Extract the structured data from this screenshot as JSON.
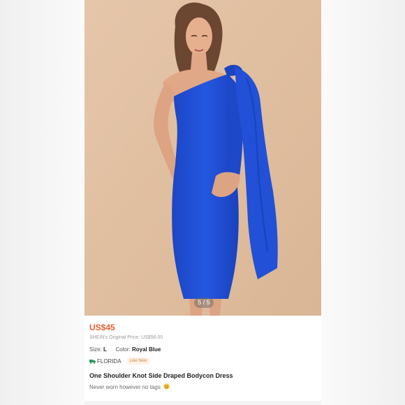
{
  "listing": {
    "image_counter": "5 / 5",
    "price": "US$45",
    "original_price": "SHEIN's Original Price: US$56.00",
    "size_label": "Size:",
    "size_value": "L",
    "color_label": "Color:",
    "color_value": "Royal Blue",
    "location": "FLORIDA",
    "condition_badge": "Like New",
    "title": "One Shoulder Knot Side Draped Bodycon Dress",
    "description": "Never worn however no tags"
  },
  "icons": {
    "shipping": "truck-icon",
    "description_emoji": "smiling-face-icon"
  },
  "colors": {
    "price": "#ea5d2e",
    "dress": "#1f4fd1",
    "photo_background": "#e1c2a5",
    "badge_background": "#fff1e4",
    "badge_text": "#c98a3f"
  }
}
